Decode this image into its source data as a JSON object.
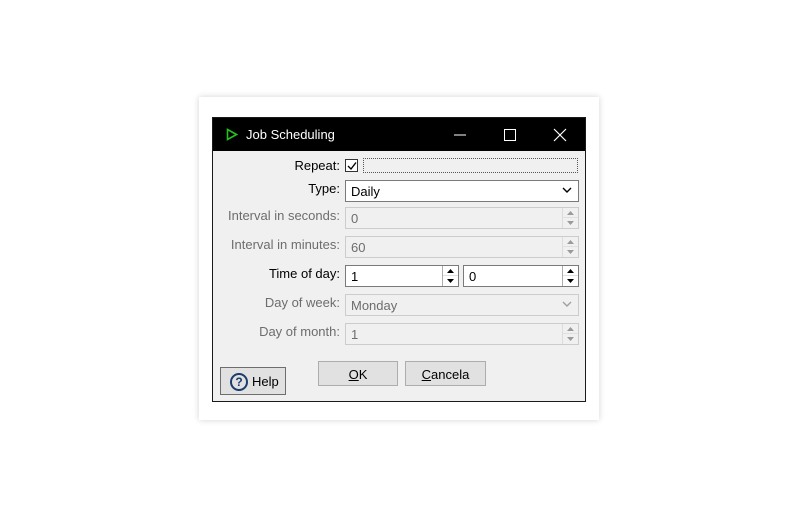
{
  "window": {
    "title": "Job Scheduling",
    "app_icon": "play-triangle-icon",
    "accent_color": "#22c122",
    "controls": [
      "minimize-icon",
      "maximize-icon",
      "close-icon"
    ]
  },
  "form": {
    "repeat": {
      "label": "Repeat:",
      "checked": true
    },
    "type": {
      "label": "Type:",
      "value": "Daily"
    },
    "interval_seconds": {
      "label": "Interval in seconds:",
      "value": "0",
      "enabled": false
    },
    "interval_minutes": {
      "label": "Interval in minutes:",
      "value": "60",
      "enabled": false
    },
    "time_of_day": {
      "label": "Time of day:",
      "hour": "1",
      "minute": "0"
    },
    "day_of_week": {
      "label": "Day of week:",
      "value": "Monday",
      "enabled": false
    },
    "day_of_month": {
      "label": "Day of month:",
      "value": "1",
      "enabled": false
    }
  },
  "buttons": {
    "help": {
      "label": "Help",
      "icon": "question-circle-icon"
    },
    "ok": {
      "label": "OK",
      "mnemonic": "O",
      "rest": "K"
    },
    "cancel": {
      "label": "Cancela",
      "mnemonic": "C",
      "rest": "ancela"
    }
  }
}
